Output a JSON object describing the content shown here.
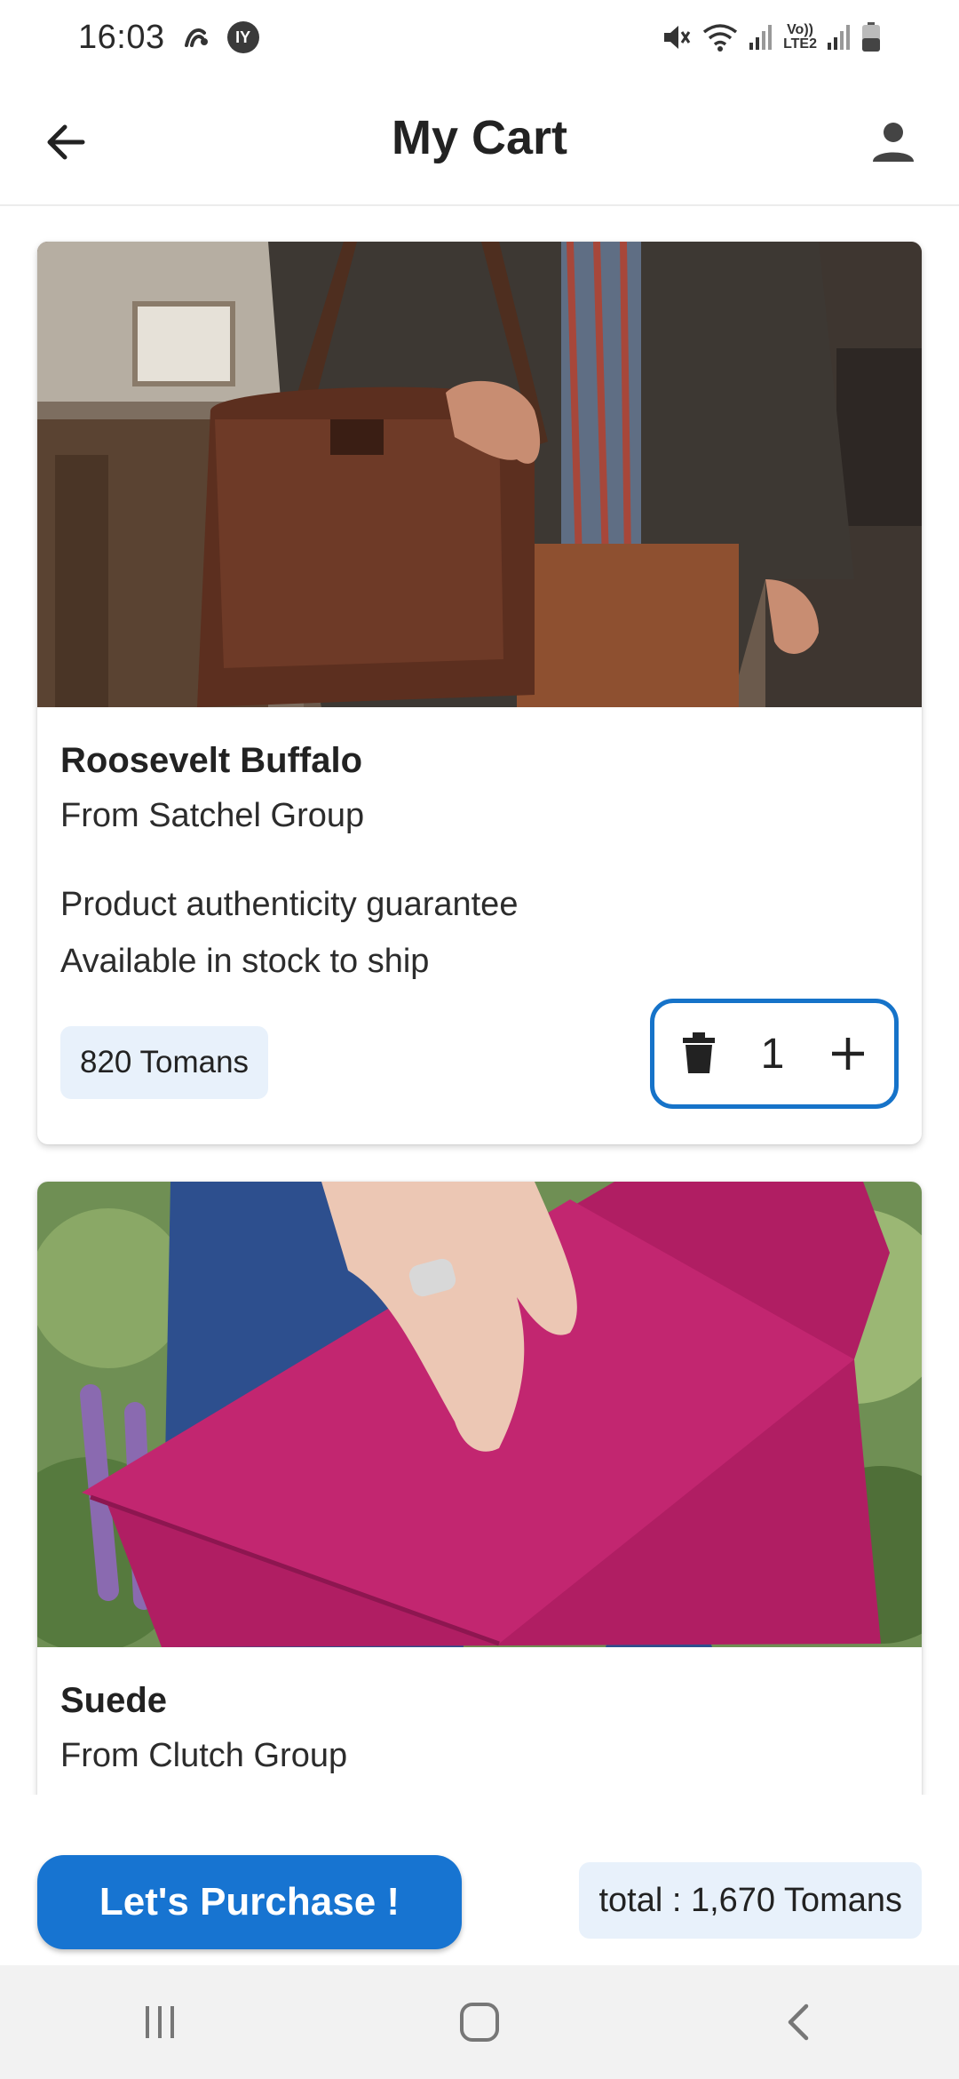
{
  "status_bar": {
    "time": "16:03",
    "badge_text": "IY",
    "volte_line1": "Vo))",
    "volte_line2": "LTE2",
    "icons": [
      "gesture-icon",
      "mute-icon",
      "wifi-icon",
      "signal-icon",
      "battery-icon"
    ]
  },
  "app_bar": {
    "title": "My Cart",
    "back_icon": "arrow-back-icon",
    "profile_icon": "person-icon"
  },
  "cart": {
    "items": [
      {
        "name": "Roosevelt Buffalo",
        "seller": "From Satchel Group",
        "features": [
          "Product authenticity guarantee",
          "Available in stock to ship"
        ],
        "price": "820 Tomans",
        "quantity": "1",
        "image_subject": "brown leather satchel bag"
      },
      {
        "name": "Suede",
        "seller": "From Clutch Group",
        "image_subject": "magenta suede clutch bag"
      }
    ]
  },
  "footer": {
    "purchase_label": "Let's Purchase !",
    "total_label": "total : 1,670 Tomans"
  },
  "colors": {
    "accent": "#1774d1",
    "chip_bg": "#e8f1fb",
    "stepper_border": "#1673c9"
  }
}
